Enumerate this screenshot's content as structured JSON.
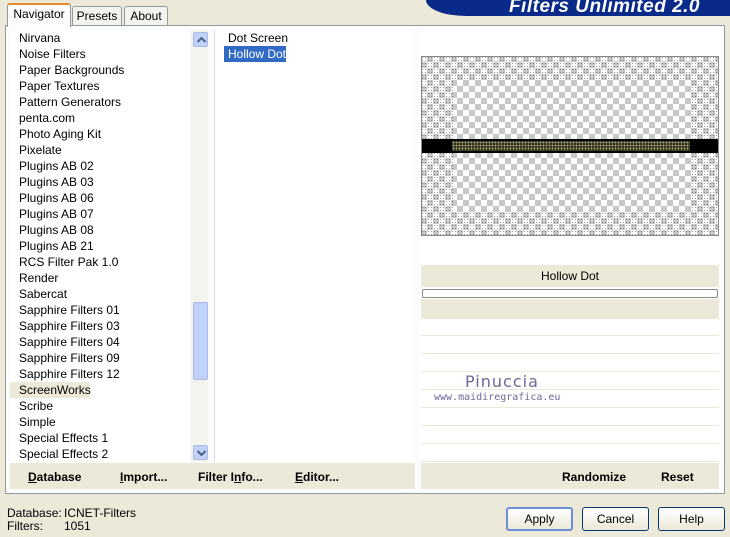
{
  "tabs": [
    {
      "label": "Navigator"
    },
    {
      "label": "Presets"
    },
    {
      "label": "About"
    }
  ],
  "banner_title": "Filters Unlimited 2.0",
  "categories": [
    "Nirvana",
    "Noise Filters",
    "Paper Backgrounds",
    "Paper Textures",
    "Pattern Generators",
    "penta.com",
    "Photo Aging Kit",
    "Pixelate",
    "Plugins AB 02",
    "Plugins AB 03",
    "Plugins AB 06",
    "Plugins AB 07",
    "Plugins AB 08",
    "Plugins AB 21",
    "RCS Filter Pak 1.0",
    "Render",
    "Sabercat",
    "Sapphire Filters 01",
    "Sapphire Filters 03",
    "Sapphire Filters 04",
    "Sapphire Filters 09",
    "Sapphire Filters 12",
    "ScreenWorks",
    "Scribe",
    "Simple",
    "Special Effects 1",
    "Special Effects 2"
  ],
  "selected_category": "ScreenWorks",
  "filters": [
    "Dot Screen",
    "Hollow Dot"
  ],
  "selected_filter": "Hollow Dot",
  "preview": {
    "filter_name": "Hollow Dot",
    "watermark": "Pinuccia",
    "watermark_url": "www.maidiregrafica.eu"
  },
  "toolbar": {
    "database_prefix": "D",
    "database_rest": "atabase",
    "import_prefix": "I",
    "import_rest": "mport...",
    "filterinfo_prefix": "Filter I",
    "filterinfo_u": "n",
    "filterinfo_rest": "fo...",
    "editor_prefix": "E",
    "editor_rest": "ditor...",
    "randomize": "Randomize",
    "reset": "Reset"
  },
  "footer": {
    "database_label": "Database:",
    "database_value": "ICNET-Filters",
    "filters_label": "Filters:",
    "filters_value": "1051",
    "apply": "Apply",
    "cancel": "Cancel",
    "help": "Help"
  }
}
